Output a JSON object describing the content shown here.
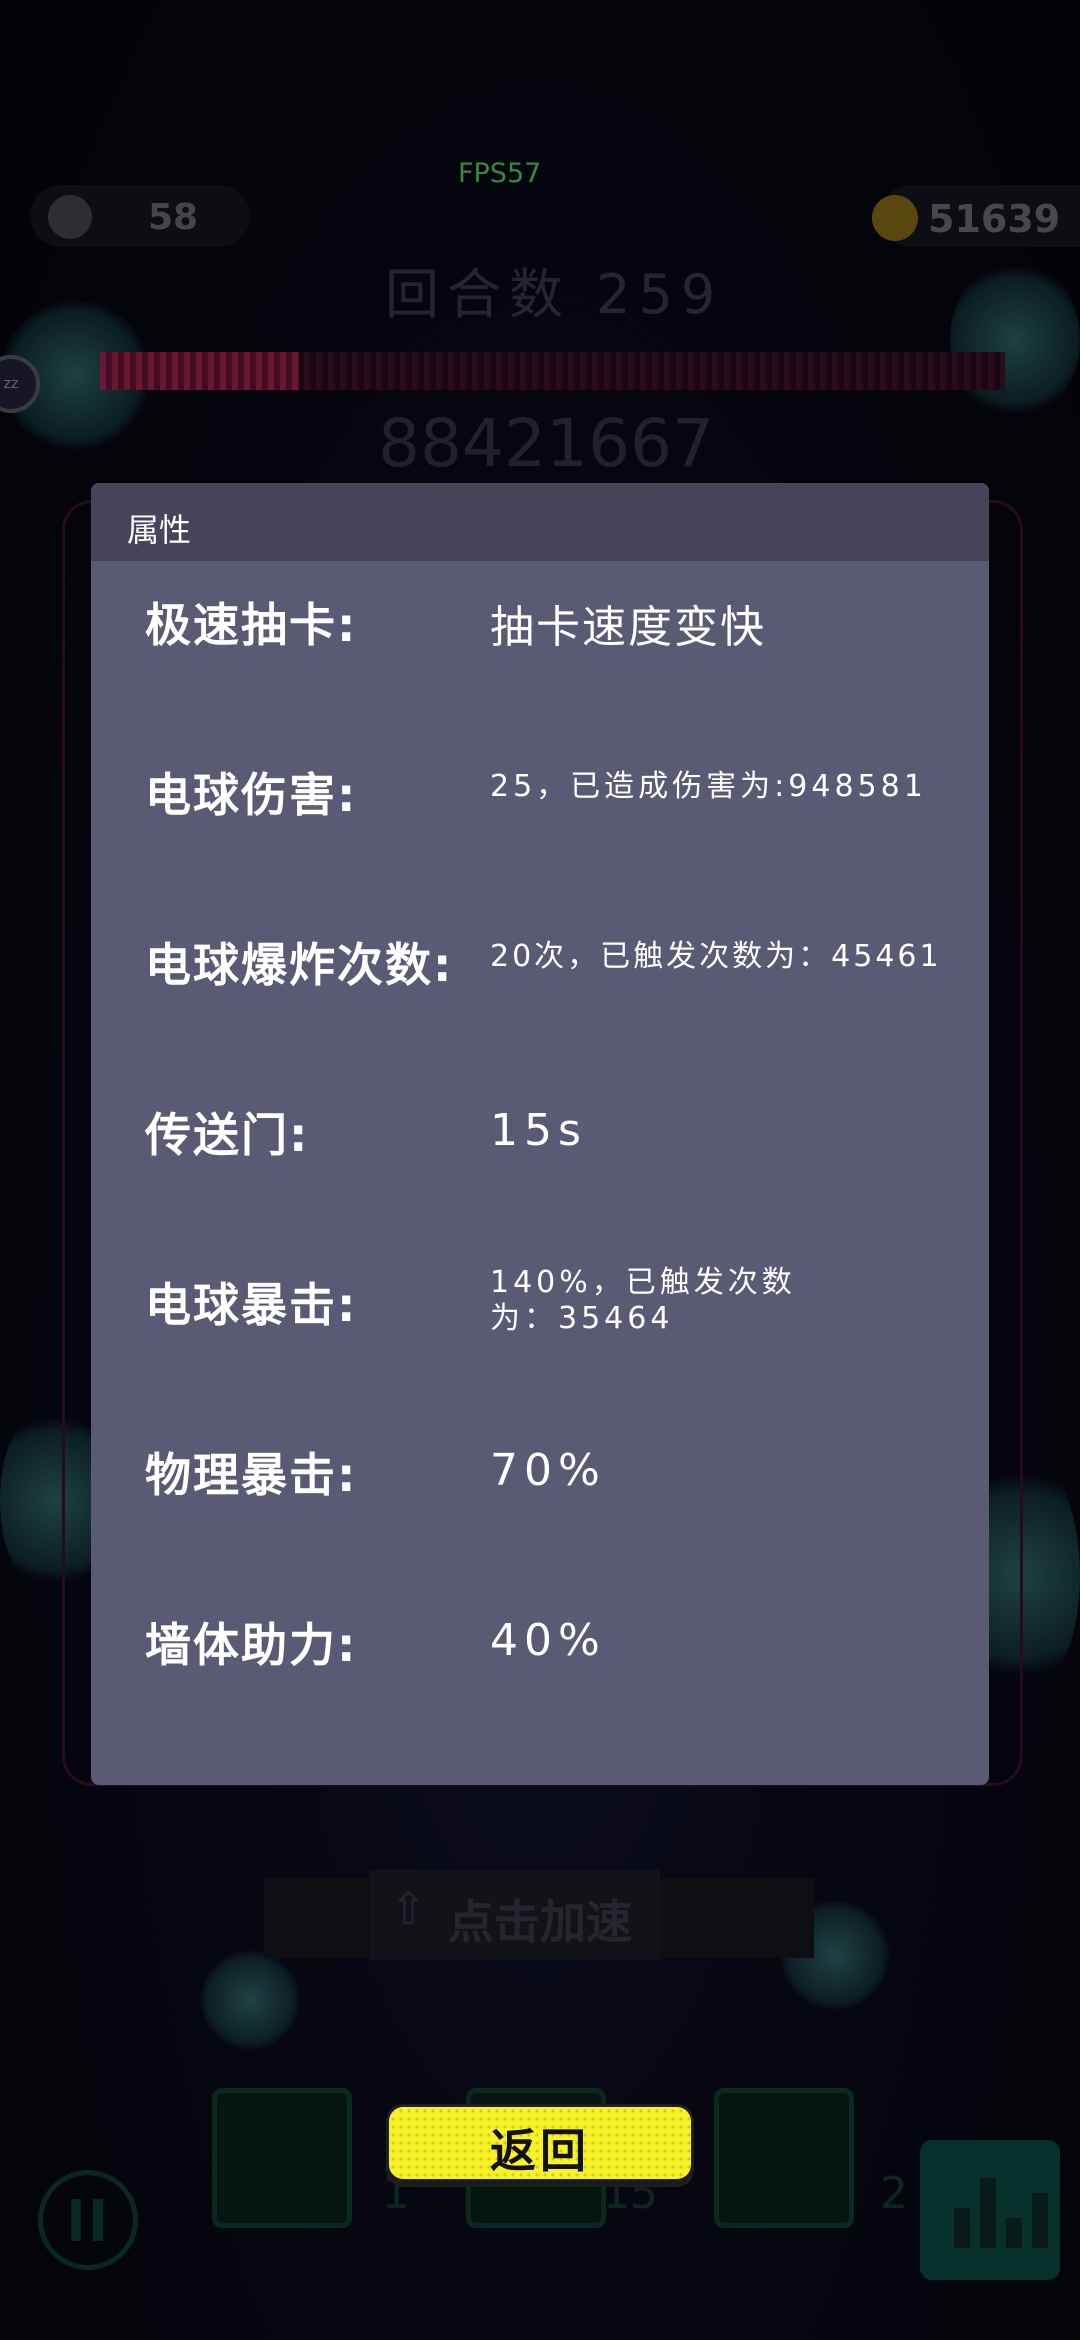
{
  "hud": {
    "fps": "FPS57",
    "balls": "58",
    "gold": "51639",
    "round": "回合数 259",
    "score": "88421667",
    "speed_up_label": "点击加速",
    "slot_counts": [
      "1",
      "15",
      "2"
    ],
    "hp_fraction": 0.22
  },
  "dialog": {
    "title": "属性",
    "attributes": [
      {
        "label": "极速抽卡:",
        "value": "抽卡速度变快"
      },
      {
        "label": "电球伤害:",
        "value": "25，已造成伤害为:948581"
      },
      {
        "label": "电球爆炸次数:",
        "value": "20次，已触发次数为：45461"
      },
      {
        "label": "传送门:",
        "value": "15s"
      },
      {
        "label": "电球暴击:",
        "value": "140%，已触发次数为：35464"
      },
      {
        "label": "物理暴击:",
        "value": "70%"
      },
      {
        "label": "墙体助力:",
        "value": "40%"
      }
    ]
  },
  "back_button": {
    "label": "返回"
  },
  "colors": {
    "dialog_body": "#5a5a74",
    "dialog_header": "#454459",
    "back_button": "#f7f229",
    "fps": "#4fd36a"
  }
}
